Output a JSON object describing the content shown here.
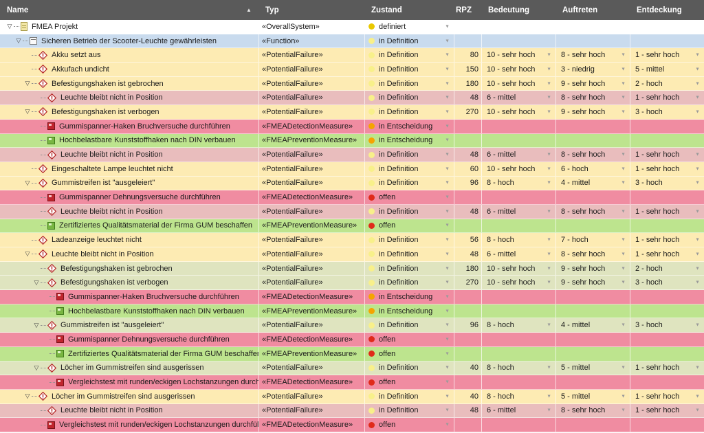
{
  "columns": [
    {
      "key": "name",
      "label": "Name"
    },
    {
      "key": "typ",
      "label": "Typ"
    },
    {
      "key": "zustand",
      "label": "Zustand"
    },
    {
      "key": "rpz",
      "label": "RPZ"
    },
    {
      "key": "bedeutung",
      "label": "Bedeutung"
    },
    {
      "key": "auftreten",
      "label": "Auftreten"
    },
    {
      "key": "entdeckung",
      "label": "Entdeckung"
    }
  ],
  "sort_indicator": "▲",
  "state_colors": {
    "definiert": "#e9c800",
    "in Definition": "#f8f08a",
    "in Entscheidung": "#f5a400",
    "offen": "#e02a1a"
  },
  "rows": [
    {
      "depth": 0,
      "toggle": "▽",
      "icon": "project",
      "name": "FMEA Projekt",
      "typ": "«OverallSystem»",
      "zustand": "definiert",
      "state": "def",
      "rpz": "",
      "bedeutung": "",
      "auftreten": "",
      "entdeckung": "",
      "bg": "white"
    },
    {
      "depth": 1,
      "toggle": "▽",
      "icon": "function",
      "name": "Sicheren Betrieb der Scooter-Leuchte gewährleisten",
      "typ": "«Function»",
      "zustand": "in Definition",
      "state": "indef",
      "rpz": "",
      "bedeutung": "",
      "auftreten": "",
      "entdeckung": "",
      "bg": "function"
    },
    {
      "depth": 2,
      "toggle": "",
      "icon": "failure",
      "name": "Akku setzt aus",
      "typ": "«PotentialFailure»",
      "zustand": "in Definition",
      "state": "indef",
      "rpz": "80",
      "bedeutung": "10 - sehr hoch",
      "auftreten": "8 - sehr hoch",
      "entdeckung": "1 - sehr hoch",
      "bg": "failure"
    },
    {
      "depth": 2,
      "toggle": "",
      "icon": "failure",
      "name": "Akkufach undicht",
      "typ": "«PotentialFailure»",
      "zustand": "in Definition",
      "state": "indef",
      "rpz": "150",
      "bedeutung": "10 - sehr hoch",
      "auftreten": "3 - niedrig",
      "entdeckung": "5 - mittel",
      "bg": "failure"
    },
    {
      "depth": 2,
      "toggle": "▽",
      "icon": "failure",
      "name": "Befestigungshaken ist gebrochen",
      "typ": "«PotentialFailure»",
      "zustand": "in Definition",
      "state": "indef",
      "rpz": "180",
      "bedeutung": "10 - sehr hoch",
      "auftreten": "9 - sehr hoch",
      "entdeckung": "2 - hoch",
      "bg": "failure"
    },
    {
      "depth": 3,
      "toggle": "",
      "icon": "failure",
      "name": "Leuchte bleibt nicht in Position",
      "typ": "«PotentialFailure»",
      "zustand": "in Definition",
      "state": "indef",
      "rpz": "48",
      "bedeutung": "6 - mittel",
      "auftreten": "8 - sehr hoch",
      "entdeckung": "1 - sehr hoch",
      "bg": "failure-pink"
    },
    {
      "depth": 2,
      "toggle": "▽",
      "icon": "failure",
      "name": "Befestigungshaken ist verbogen",
      "typ": "«PotentialFailure»",
      "zustand": "in Definition",
      "state": "indef",
      "rpz": "270",
      "bedeutung": "10 - sehr hoch",
      "auftreten": "9 - sehr hoch",
      "entdeckung": "3 - hoch",
      "bg": "failure"
    },
    {
      "depth": 3,
      "toggle": "",
      "icon": "detection",
      "name": "Gummispanner-Haken Bruchversuche durchführen",
      "typ": "«FMEADetectionMeasure»",
      "zustand": "in Entscheidung",
      "state": "entsch",
      "rpz": "",
      "bedeutung": "",
      "auftreten": "",
      "entdeckung": "",
      "bg": "detection"
    },
    {
      "depth": 3,
      "toggle": "",
      "icon": "prevention",
      "name": "Hochbelastbare Kunststoffhaken nach DIN verbauen",
      "typ": "«FMEAPreventionMeasure»",
      "zustand": "in Entscheidung",
      "state": "entsch",
      "rpz": "",
      "bedeutung": "",
      "auftreten": "",
      "entdeckung": "",
      "bg": "prevention"
    },
    {
      "depth": 3,
      "toggle": "",
      "icon": "failure",
      "name": "Leuchte bleibt nicht in Position",
      "typ": "«PotentialFailure»",
      "zustand": "in Definition",
      "state": "indef",
      "rpz": "48",
      "bedeutung": "6 - mittel",
      "auftreten": "8 - sehr hoch",
      "entdeckung": "1 - sehr hoch",
      "bg": "failure-pink"
    },
    {
      "depth": 2,
      "toggle": "",
      "icon": "failure",
      "name": "Eingeschaltete Lampe leuchtet nicht",
      "typ": "«PotentialFailure»",
      "zustand": "in Definition",
      "state": "indef",
      "rpz": "60",
      "bedeutung": "10 - sehr hoch",
      "auftreten": "6 - hoch",
      "entdeckung": "1 - sehr hoch",
      "bg": "failure"
    },
    {
      "depth": 2,
      "toggle": "▽",
      "icon": "failure",
      "name": "Gummistreifen ist \"ausgeleiert\"",
      "typ": "«PotentialFailure»",
      "zustand": "in Definition",
      "state": "indef",
      "rpz": "96",
      "bedeutung": "8 - hoch",
      "auftreten": "4 - mittel",
      "entdeckung": "3 - hoch",
      "bg": "failure"
    },
    {
      "depth": 3,
      "toggle": "",
      "icon": "detection",
      "name": "Gummispanner Dehnungsversuche durchführen",
      "typ": "«FMEADetectionMeasure»",
      "zustand": "offen",
      "state": "offen",
      "rpz": "",
      "bedeutung": "",
      "auftreten": "",
      "entdeckung": "",
      "bg": "detection"
    },
    {
      "depth": 3,
      "toggle": "",
      "icon": "failure",
      "name": "Leuchte bleibt nicht in Position",
      "typ": "«PotentialFailure»",
      "zustand": "in Definition",
      "state": "indef",
      "rpz": "48",
      "bedeutung": "6 - mittel",
      "auftreten": "8 - sehr hoch",
      "entdeckung": "1 - sehr hoch",
      "bg": "failure-pink"
    },
    {
      "depth": 3,
      "toggle": "",
      "icon": "prevention",
      "name": "Zertifiziertes Qualitätsmaterial der Firma GUM beschaffen",
      "typ": "«FMEAPreventionMeasure»",
      "zustand": "offen",
      "state": "offen",
      "rpz": "",
      "bedeutung": "",
      "auftreten": "",
      "entdeckung": "",
      "bg": "prevention"
    },
    {
      "depth": 2,
      "toggle": "",
      "icon": "failure",
      "name": "Ladeanzeige leuchtet nicht",
      "typ": "«PotentialFailure»",
      "zustand": "in Definition",
      "state": "indef",
      "rpz": "56",
      "bedeutung": "8 - hoch",
      "auftreten": "7 - hoch",
      "entdeckung": "1 - sehr hoch",
      "bg": "failure"
    },
    {
      "depth": 2,
      "toggle": "▽",
      "icon": "failure",
      "name": "Leuchte bleibt nicht in Position",
      "typ": "«PotentialFailure»",
      "zustand": "in Definition",
      "state": "indef",
      "rpz": "48",
      "bedeutung": "6 - mittel",
      "auftreten": "8 - sehr hoch",
      "entdeckung": "1 - sehr hoch",
      "bg": "failure"
    },
    {
      "depth": 3,
      "toggle": "",
      "icon": "failure",
      "name": "Befestigungshaken ist gebrochen",
      "typ": "«PotentialFailure»",
      "zustand": "in Definition",
      "state": "indef",
      "rpz": "180",
      "bedeutung": "10 - sehr hoch",
      "auftreten": "9 - sehr hoch",
      "entdeckung": "2 - hoch",
      "bg": "failure-green"
    },
    {
      "depth": 3,
      "toggle": "▽",
      "icon": "failure",
      "name": "Befestigungshaken ist verbogen",
      "typ": "«PotentialFailure»",
      "zustand": "in Definition",
      "state": "indef",
      "rpz": "270",
      "bedeutung": "10 - sehr hoch",
      "auftreten": "9 - sehr hoch",
      "entdeckung": "3 - hoch",
      "bg": "failure-green"
    },
    {
      "depth": 4,
      "toggle": "",
      "icon": "detection",
      "name": "Gummispanner-Haken Bruchversuche durchführen",
      "typ": "«FMEADetectionMeasure»",
      "zustand": "in Entscheidung",
      "state": "entsch",
      "rpz": "",
      "bedeutung": "",
      "auftreten": "",
      "entdeckung": "",
      "bg": "detection"
    },
    {
      "depth": 4,
      "toggle": "",
      "icon": "prevention",
      "name": "Hochbelastbare Kunststoffhaken nach DIN verbauen",
      "typ": "«FMEAPreventionMeasure»",
      "zustand": "in Entscheidung",
      "state": "entsch",
      "rpz": "",
      "bedeutung": "",
      "auftreten": "",
      "entdeckung": "",
      "bg": "prevention"
    },
    {
      "depth": 3,
      "toggle": "▽",
      "icon": "failure",
      "name": "Gummistreifen ist \"ausgeleiert\"",
      "typ": "«PotentialFailure»",
      "zustand": "in Definition",
      "state": "indef",
      "rpz": "96",
      "bedeutung": "8 - hoch",
      "auftreten": "4 - mittel",
      "entdeckung": "3 - hoch",
      "bg": "failure-green"
    },
    {
      "depth": 4,
      "toggle": "",
      "icon": "detection",
      "name": "Gummispanner Dehnungsversuche durchführen",
      "typ": "«FMEADetectionMeasure»",
      "zustand": "offen",
      "state": "offen",
      "rpz": "",
      "bedeutung": "",
      "auftreten": "",
      "entdeckung": "",
      "bg": "detection"
    },
    {
      "depth": 4,
      "toggle": "",
      "icon": "prevention",
      "name": "Zertifiziertes Qualitätsmaterial der Firma GUM beschaffen",
      "typ": "«FMEAPreventionMeasure»",
      "zustand": "offen",
      "state": "offen",
      "rpz": "",
      "bedeutung": "",
      "auftreten": "",
      "entdeckung": "",
      "bg": "prevention"
    },
    {
      "depth": 3,
      "toggle": "▽",
      "icon": "failure",
      "name": "Löcher im Gummistreifen sind ausgerissen",
      "typ": "«PotentialFailure»",
      "zustand": "in Definition",
      "state": "indef",
      "rpz": "40",
      "bedeutung": "8 - hoch",
      "auftreten": "5 - mittel",
      "entdeckung": "1 - sehr hoch",
      "bg": "failure-green"
    },
    {
      "depth": 4,
      "toggle": "",
      "icon": "detection",
      "name": "Vergleichstest mit runden/eckigen Lochstanzungen durch",
      "typ": "«FMEADetectionMeasure»",
      "zustand": "offen",
      "state": "offen",
      "rpz": "",
      "bedeutung": "",
      "auftreten": "",
      "entdeckung": "",
      "bg": "detection"
    },
    {
      "depth": 2,
      "toggle": "▽",
      "icon": "failure",
      "name": "Löcher im Gummistreifen sind ausgerissen",
      "typ": "«PotentialFailure»",
      "zustand": "in Definition",
      "state": "indef",
      "rpz": "40",
      "bedeutung": "8 - hoch",
      "auftreten": "5 - mittel",
      "entdeckung": "1 - sehr hoch",
      "bg": "failure"
    },
    {
      "depth": 3,
      "toggle": "",
      "icon": "failure",
      "name": "Leuchte bleibt nicht in Position",
      "typ": "«PotentialFailure»",
      "zustand": "in Definition",
      "state": "indef",
      "rpz": "48",
      "bedeutung": "6 - mittel",
      "auftreten": "8 - sehr hoch",
      "entdeckung": "1 - sehr hoch",
      "bg": "failure-pink"
    },
    {
      "depth": 3,
      "toggle": "",
      "icon": "detection",
      "name": "Vergleichstest mit runden/eckigen Lochstanzungen durchfül",
      "typ": "«FMEADetectionMeasure»",
      "zustand": "offen",
      "state": "offen",
      "rpz": "",
      "bedeutung": "",
      "auftreten": "",
      "entdeckung": "",
      "bg": "detection"
    }
  ]
}
